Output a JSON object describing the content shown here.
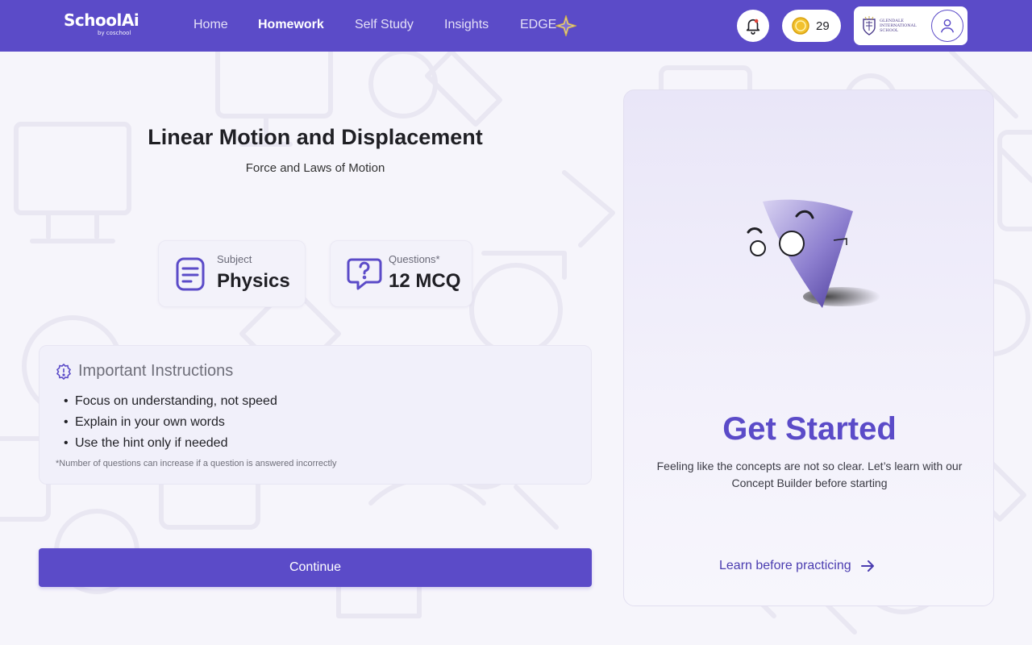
{
  "header": {
    "brand": "SchoolAi",
    "brand_sub": "by coschool",
    "nav": [
      "Home",
      "Homework",
      "Self Study",
      "Insights",
      "EDGE"
    ],
    "active_nav": "Homework",
    "coins": "29",
    "school_name": "GLENDALE INTERNATIONAL SCHOOL"
  },
  "main": {
    "title": "Linear Motion and Displacement",
    "subtitle": "Force and Laws of Motion",
    "subject_label": "Subject",
    "subject_value": "Physics",
    "questions_label": "Questions*",
    "questions_value": "12 MCQ",
    "instructions_title": "Important Instructions",
    "instructions": [
      "Focus on understanding, not speed",
      "Explain in your own words",
      "Use the hint only if needed"
    ],
    "instructions_note": "*Number of questions can increase if a question is answered incorrectly",
    "continue_label": "Continue"
  },
  "side_card": {
    "title": "Get Started",
    "description": "Feeling like the concepts are not so clear. Let’s learn with our Concept Builder before starting",
    "link_label": "Learn before practicing"
  },
  "colors": {
    "primary": "#5b4bc8",
    "background": "#f6f5fb",
    "card": "#f3f2fa"
  },
  "icons": [
    "bell-icon",
    "coin-icon",
    "user-icon",
    "edge-star-icon",
    "document-icon",
    "question-bubble-icon",
    "info-icon",
    "arrow-right-icon"
  ]
}
